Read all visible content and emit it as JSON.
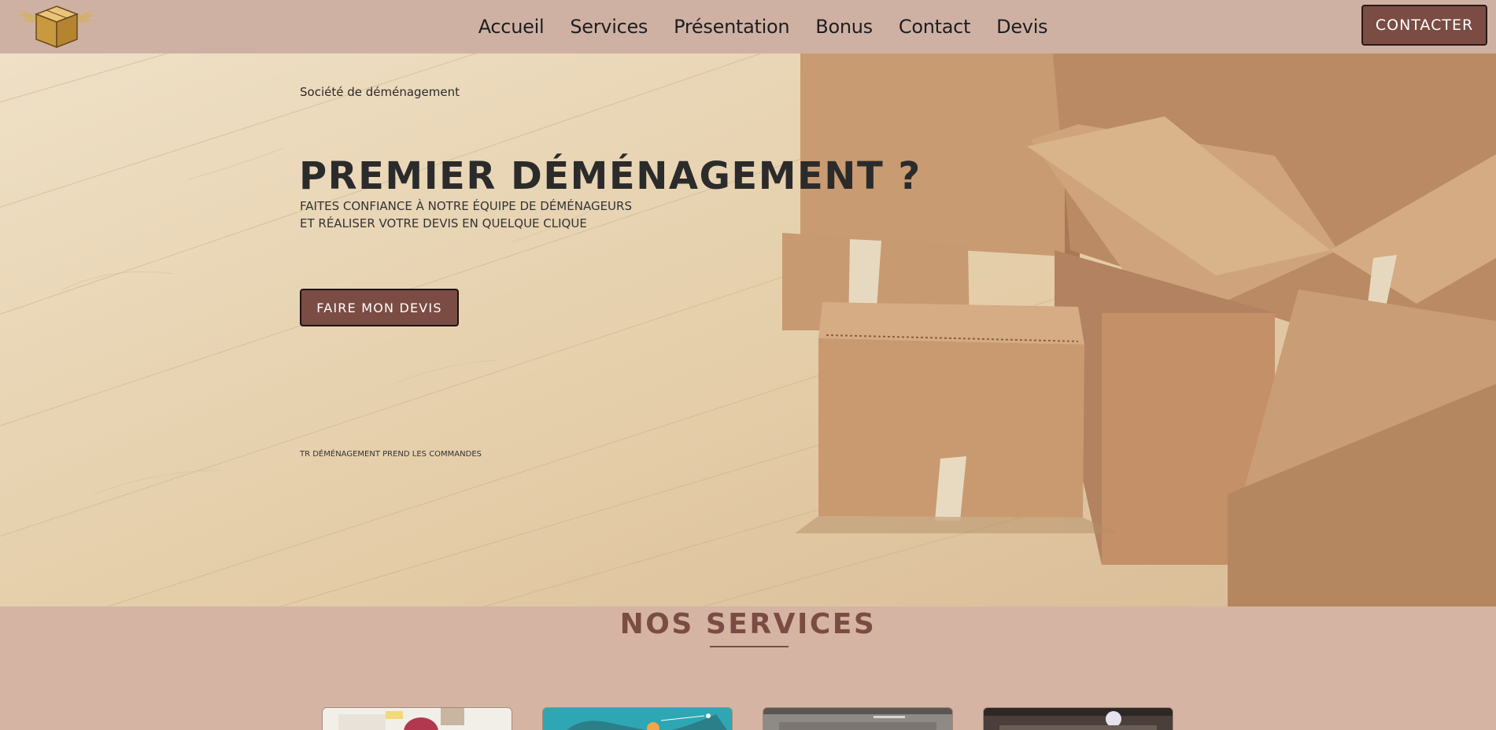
{
  "nav": {
    "items": [
      {
        "label": "Accueil"
      },
      {
        "label": "Services"
      },
      {
        "label": "Présentation"
      },
      {
        "label": "Bonus"
      },
      {
        "label": "Contact"
      },
      {
        "label": "Devis"
      }
    ],
    "contact_label": "CONTACTER"
  },
  "hero": {
    "eyebrow": "Société de déménagement",
    "title": "PREMIER DÉMÉNAGEMENT ?",
    "subtitle_line1": "FAITES CONFIANCE À NOTRE ÉQUIPE DE DÉMÉNAGEURS",
    "subtitle_line2": "ET RÉALISER VOTRE DEVIS EN QUELQUE CLIQUE",
    "cta_label": "FAIRE MON DEVIS",
    "note": "TR DÉMÉNAGEMENT PREND LES COMMANDES"
  },
  "services": {
    "title": "NOS SERVICES"
  },
  "colors": {
    "header_bg": "#cfb1a4",
    "page_bg": "#d6b4a4",
    "accent": "#7b4c43"
  },
  "icons": {
    "logo": "winged-box-logo"
  }
}
